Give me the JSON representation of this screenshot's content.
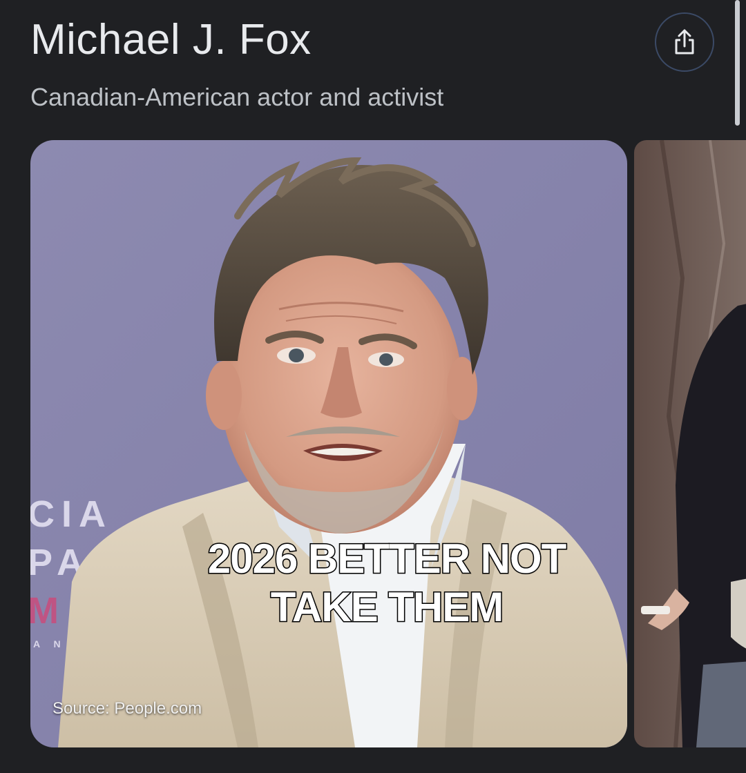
{
  "header": {
    "title": "Michael J. Fox",
    "subtitle": "Canadian-American actor and activist"
  },
  "share_button": {
    "icon": "share-icon"
  },
  "carousel": {
    "main_image": {
      "alt": "Michael J. Fox",
      "backdrop_letters": [
        "CIA",
        "PA",
        "M"
      ],
      "source_label": "Source: People.com"
    },
    "next_image": {
      "alt": "Michael J. Fox"
    }
  },
  "overlay": {
    "caption_line1": "2026 BETTER NOT",
    "caption_line2": "TAKE THEM"
  },
  "colors": {
    "background": "#1f2023",
    "title": "#e8eaed",
    "subtitle": "#bdc1c6",
    "backdrop": "#8e8bb1",
    "share_ring": "#3b4a66"
  }
}
